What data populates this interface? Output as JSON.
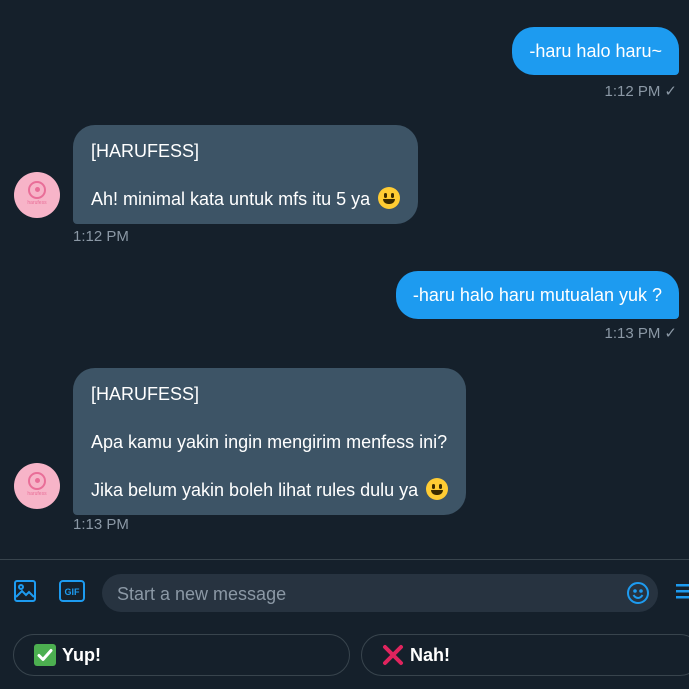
{
  "conversation": {
    "messages": [
      {
        "direction": "outgoing",
        "text": "-haru halo haru~",
        "time": "1:12 PM"
      },
      {
        "direction": "incoming",
        "lines": [
          "[HARUFESS]",
          "Ah! minimal kata untuk mfs itu 5 ya"
        ],
        "time": "1:12 PM"
      },
      {
        "direction": "outgoing",
        "text": "-haru halo haru mutualan yuk ?",
        "time": "1:13 PM"
      },
      {
        "direction": "incoming",
        "lines": [
          "[HARUFESS]",
          "Apa kamu yakin ingin mengirim menfess ini?",
          "Jika belum yakin boleh lihat rules dulu ya"
        ],
        "time": "1:13 PM"
      }
    ],
    "read_mark": "✓"
  },
  "composer": {
    "placeholder": "Start a new message",
    "gif_label": "GIF"
  },
  "quick_replies": [
    {
      "label": "Yup!",
      "icon": "check-mark-icon"
    },
    {
      "label": "Nah!",
      "icon": "cross-mark-icon"
    }
  ],
  "colors": {
    "background": "#15202b",
    "outgoing_bubble": "#1d9bf0",
    "incoming_bubble": "#3d5466",
    "accent": "#1d9bf0",
    "muted": "#8b98a5"
  }
}
